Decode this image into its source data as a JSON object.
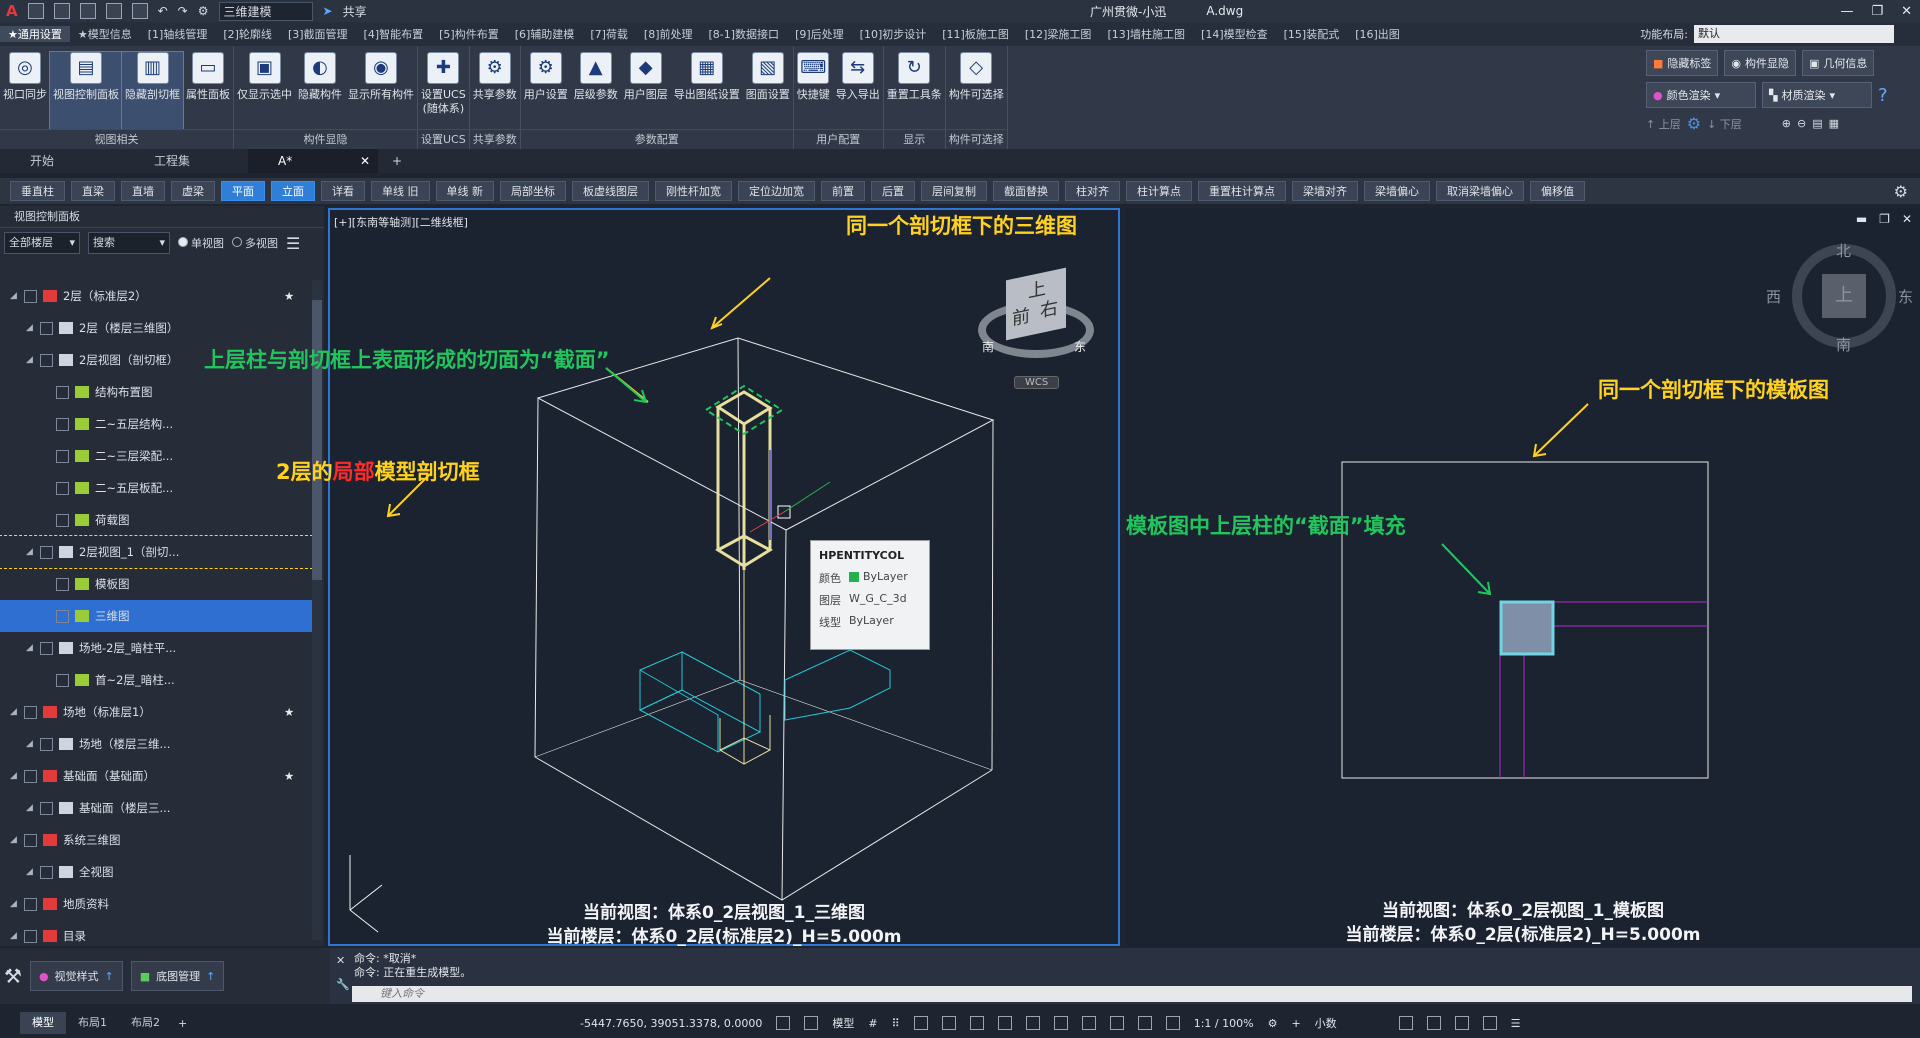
{
  "titlebar": {
    "workspace": "三维建模",
    "share": "共享",
    "app_user": "广州贯微-小迅",
    "filename": "A.dwg"
  },
  "ribbon_tabs": [
    "★通用设置",
    "★模型信息",
    "[1]轴线管理",
    "[2]轮廓线",
    "[3]截面管理",
    "[4]智能布置",
    "[5]构件布置",
    "[6]辅助建模",
    "[7]荷载",
    "[8]前处理",
    "[8-1]数据接口",
    "[9]后处理",
    "[10]初步设计",
    "[11]板施工图",
    "[12]梁施工图",
    "[13]墙柱施工图",
    "[14]模型检查",
    "[15]装配式",
    "[16]出图"
  ],
  "layout": {
    "label": "功能布局:",
    "value": "默认"
  },
  "ribbon_groups": [
    {
      "label": "视图相关",
      "buttons": [
        "视口同步",
        "视图控制面板",
        "隐藏剖切框",
        "属性面板"
      ]
    },
    {
      "label": "构件显隐",
      "buttons": [
        "仅显示选中",
        "隐藏构件",
        "显示所有构件"
      ]
    },
    {
      "label": "设置UCS",
      "buttons": [
        "设置UCS\n(随体系)"
      ]
    },
    {
      "label": "共享参数",
      "buttons": [
        "共享参数"
      ]
    },
    {
      "label": "参数配置",
      "buttons": [
        "用户设置",
        "层级参数",
        "用户图层",
        "导出图纸设置",
        "图面设置"
      ]
    },
    {
      "label": "用户配置",
      "buttons": [
        "快捷键",
        "导入导出"
      ]
    },
    {
      "label": "显示",
      "buttons": [
        "重置工具条"
      ]
    },
    {
      "label": "构件可选择",
      "buttons": [
        "构件可选择"
      ]
    }
  ],
  "right_ribbon": {
    "row1": [
      "隐藏标签",
      "构件显隐",
      "几何信息"
    ],
    "row2": [
      "颜色渲染",
      "材质渲染"
    ],
    "row3": [
      "上层",
      "下层"
    ]
  },
  "doc_tabs": [
    "开始",
    "工程集",
    "A*"
  ],
  "cmd_buttons": [
    "垂直柱",
    "直梁",
    "直墙",
    "虚梁",
    "平面",
    "立面",
    "详看",
    "单线 旧",
    "单线 新",
    "局部坐标",
    "板虚线图层",
    "刚性杆加宽",
    "定位边加宽",
    "前置",
    "后置",
    "层间复制",
    "截面替换",
    "柱对齐",
    "柱计算点",
    "重置柱计算点",
    "梁墙对齐",
    "梁墙偏心",
    "取消梁墙偏心",
    "偏移值"
  ],
  "left_panel": {
    "title": "视图控制面板",
    "floor_filter": "全部楼层",
    "search": "搜索",
    "radio_single": "单视图",
    "radio_multi": "多视图",
    "tree": [
      {
        "label": "2层（标准层2）",
        "indent": 0,
        "selected": false
      },
      {
        "label": "2层（楼层三维图）",
        "indent": 1,
        "selected": false
      },
      {
        "label": "2层视图（剖切框）",
        "indent": 1,
        "selected": false
      },
      {
        "label": "结构布置图",
        "indent": 2,
        "selected": false
      },
      {
        "label": "二~五层结构...",
        "indent": 2,
        "selected": false
      },
      {
        "label": "二~三层梁配...",
        "indent": 2,
        "selected": false
      },
      {
        "label": "二~五层板配...",
        "indent": 2,
        "selected": false
      },
      {
        "label": "荷载图",
        "indent": 2,
        "selected": false
      },
      {
        "label": "2层视图_1（剖切...",
        "indent": 1,
        "selected": false
      },
      {
        "label": "模板图",
        "indent": 2,
        "selected": false
      },
      {
        "label": "三维图",
        "indent": 2,
        "selected": true
      },
      {
        "label": "场地-2层_暗柱平...",
        "indent": 1,
        "selected": false
      },
      {
        "label": "首~2层_暗柱...",
        "indent": 2,
        "selected": false
      },
      {
        "label": "场地（标准层1）",
        "indent": 0,
        "selected": false
      },
      {
        "label": "场地（楼层三维...",
        "indent": 1,
        "selected": false
      },
      {
        "label": "基础面（基础面）",
        "indent": 0,
        "selected": false
      },
      {
        "label": "基础面（楼层三...",
        "indent": 1,
        "selected": false
      },
      {
        "label": "系统三维图",
        "indent": 0,
        "selected": false
      },
      {
        "label": "全视图",
        "indent": 1,
        "selected": false
      },
      {
        "label": "地质资料",
        "indent": 0,
        "selected": false
      },
      {
        "label": "目录",
        "indent": 0,
        "selected": false
      }
    ]
  },
  "viewport_left": {
    "label": "[+][东南等轴测][二维线框]",
    "annot_title": "同一个剖切框下的三维图",
    "annot_cut": "上层柱与剖切框上表面形成的切面为“截面”",
    "annot_box_pre": "2层的",
    "annot_box_red": "局部",
    "annot_box_post": "模型剖切框",
    "footer_view": "当前视图：体系0_2层视图_1_三维图",
    "footer_floor": "当前楼层：体系0_2层(标准层2)_H=5.000m",
    "viewcube_top": "上",
    "viewcube_front": "前",
    "viewcube_right": "右",
    "viewcube_s": "南",
    "viewcube_e": "东",
    "wcs": "WCS",
    "tooltip": {
      "title": "HPENTITYCOL",
      "rows": [
        {
          "key": "颜色",
          "value": "ByLayer",
          "color": "#22b14c"
        },
        {
          "key": "图层",
          "value": "W_G_C_3d"
        },
        {
          "key": "线型",
          "value": "ByLayer"
        }
      ]
    }
  },
  "viewport_right": {
    "annot_title": "同一个剖切框下的模板图",
    "annot_fill": "模板图中上层柱的“截面”填充",
    "footer_view": "当前视图：体系0_2层视图_1_模板图",
    "footer_floor": "当前楼层：体系0_2层(标准层2)_H=5.000m",
    "compass": {
      "n": "北",
      "s": "南",
      "e": "东",
      "w": "西",
      "center": "上"
    }
  },
  "bottom_panel": [
    "视觉样式",
    "底图管理"
  ],
  "command": {
    "line1": "命令: *取消*",
    "line2": "命令:   正在重生成模型。",
    "placeholder": "键入命令"
  },
  "status": {
    "tabs": [
      "模型",
      "布局1",
      "布局2"
    ],
    "coords": "-5447.7650, 39051.3378, 0.0000",
    "mode": "模型",
    "scale": "1:1 / 100%",
    "units": "小数"
  },
  "colors": {
    "accent": "#2f76d2",
    "annot_yellow": "#ffd21f",
    "annot_green": "#21c55d",
    "column_khaki": "#e6df9e",
    "beam_cyan": "#22c7d6",
    "beam_magenta": "#b52bd6",
    "fill_section": "#7f8fa8"
  }
}
